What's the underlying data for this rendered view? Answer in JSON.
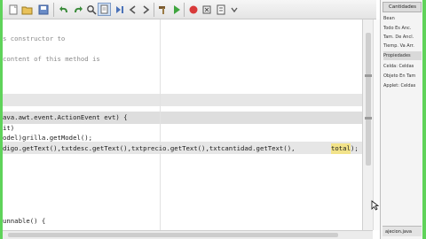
{
  "toolbar": {
    "buttons": [
      "new-file",
      "open",
      "save",
      "undo",
      "redo",
      "find",
      "back",
      "forward",
      "step",
      "run-class",
      "build",
      "clean",
      "stop",
      "debug",
      "profile",
      "extra"
    ]
  },
  "editor": {
    "lines": [
      {
        "text": "s constructor to",
        "kind": "comment"
      },
      {
        "text": "content of this method is",
        "kind": "comment"
      },
      {
        "text": "ava.awt.event.ActionEvent evt) {",
        "kind": "code"
      },
      {
        "text": "it)",
        "kind": "code"
      },
      {
        "text": "odel)grilla.getModel();",
        "kind": "code"
      },
      {
        "text": "digo.getText(),txtdesc.getText(),txtprecio.getText(),txtcantidad.getText(),",
        "kind": "code"
      },
      {
        "text": "total",
        "kind": "caret"
      },
      {
        "text": ");",
        "kind": "code"
      },
      {
        "text": "unnable() {",
        "kind": "code"
      }
    ]
  },
  "palette": {
    "header": "Cantidades",
    "items": [
      "Bean",
      "Todo Es Anc.",
      "Tam. De Ancl.",
      "Tiemp. Va Arr.",
      "Propiedades",
      "Celda: Celdas",
      "Objeto En Tam",
      "Applet: Celdas"
    ],
    "bottom_label": "ajecion.java"
  }
}
